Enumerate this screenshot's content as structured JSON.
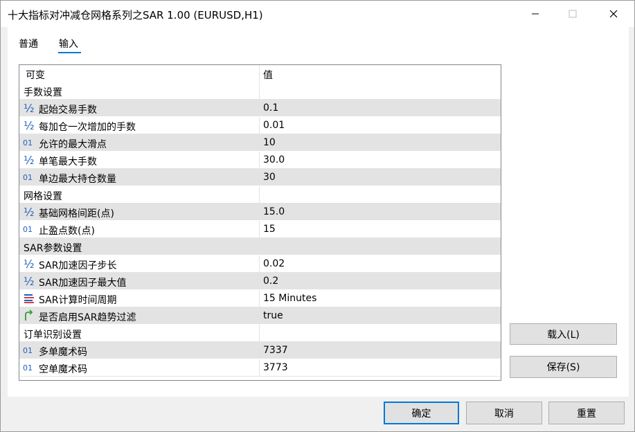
{
  "window": {
    "title": "十大指标对冲减仓网格系列之SAR 1.00 (EURUSD,H1)",
    "min_glyph": "—",
    "max_glyph": "☐",
    "close_glyph": "✕"
  },
  "tabs": [
    {
      "label": "普通"
    },
    {
      "label": "输入"
    }
  ],
  "grid": {
    "headers": {
      "name": "可变",
      "value": "值"
    },
    "rows": [
      {
        "kind": "group",
        "name": "手数设置",
        "value": ""
      },
      {
        "kind": "param",
        "icon": "fraction-icon",
        "glyph": "½",
        "name": "起始交易手数",
        "value": "0.1"
      },
      {
        "kind": "param",
        "icon": "fraction-icon",
        "glyph": "½",
        "name": "每加仓一次增加的手数",
        "value": "0.01"
      },
      {
        "kind": "param",
        "icon": "integer-icon",
        "glyph": "01",
        "name": "允许的最大滑点",
        "value": "10"
      },
      {
        "kind": "param",
        "icon": "fraction-icon",
        "glyph": "½",
        "name": "单笔最大手数",
        "value": "30.0"
      },
      {
        "kind": "param",
        "icon": "integer-icon",
        "glyph": "01",
        "name": "单边最大持仓数量",
        "value": "30"
      },
      {
        "kind": "group",
        "name": "网格设置",
        "value": ""
      },
      {
        "kind": "param",
        "icon": "fraction-icon",
        "glyph": "½",
        "name": "基础网格间距(点)",
        "value": "15.0"
      },
      {
        "kind": "param",
        "icon": "integer-icon",
        "glyph": "01",
        "name": "止盈点数(点)",
        "value": "15"
      },
      {
        "kind": "group",
        "name": "SAR参数设置",
        "value": ""
      },
      {
        "kind": "param",
        "icon": "fraction-icon",
        "glyph": "½",
        "name": "SAR加速因子步长",
        "value": "0.02"
      },
      {
        "kind": "param",
        "icon": "fraction-icon",
        "glyph": "½",
        "name": "SAR加速因子最大值",
        "value": "0.2"
      },
      {
        "kind": "param",
        "icon": "enum-icon",
        "glyph": "",
        "name": "SAR计算时间周期",
        "value": "15 Minutes"
      },
      {
        "kind": "param",
        "icon": "bool-icon",
        "glyph": "",
        "name": "是否启用SAR趋势过滤",
        "value": "true"
      },
      {
        "kind": "group",
        "name": "订单识别设置",
        "value": ""
      },
      {
        "kind": "param",
        "icon": "integer-icon",
        "glyph": "01",
        "name": "多单魔术码",
        "value": "7337"
      },
      {
        "kind": "param",
        "icon": "integer-icon",
        "glyph": "01",
        "name": "空单魔术码",
        "value": "3773"
      }
    ]
  },
  "side_buttons": {
    "load": "载入(L)",
    "save": "保存(S)"
  },
  "footer_buttons": {
    "ok": "确定",
    "cancel": "取消",
    "reset": "重置"
  },
  "colors": {
    "accent": "#0078d7",
    "icon_blue": "#1f5fbf",
    "icon_red": "#d83b3b",
    "icon_green": "#2e9e3a"
  }
}
